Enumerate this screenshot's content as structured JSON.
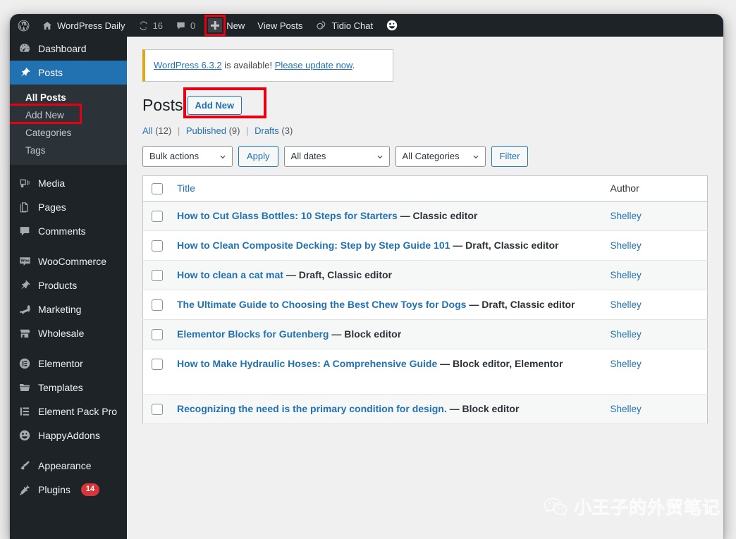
{
  "adminbar": {
    "site_name": "WordPress Daily",
    "updates_count": "16",
    "comments_count": "0",
    "new_label": "New",
    "view_posts_label": "View Posts",
    "tidio_label": "Tidio Chat"
  },
  "sidebar": {
    "items": [
      {
        "label": "Dashboard",
        "icon": "dashboard-icon"
      },
      {
        "label": "Posts",
        "icon": "pin-icon",
        "current": true
      },
      {
        "label": "Media",
        "icon": "media-icon"
      },
      {
        "label": "Pages",
        "icon": "pages-icon"
      },
      {
        "label": "Comments",
        "icon": "comment-icon"
      },
      {
        "label": "WooCommerce",
        "icon": "woocommerce-icon"
      },
      {
        "label": "Products",
        "icon": "pin-icon"
      },
      {
        "label": "Marketing",
        "icon": "megaphone-icon"
      },
      {
        "label": "Wholesale",
        "icon": "store-icon"
      },
      {
        "label": "Elementor",
        "icon": "elementor-icon"
      },
      {
        "label": "Templates",
        "icon": "folder-icon"
      },
      {
        "label": "Element Pack Pro",
        "icon": "element-pack-icon"
      },
      {
        "label": "HappyAddons",
        "icon": "happy-face-icon"
      },
      {
        "label": "Appearance",
        "icon": "brush-icon"
      },
      {
        "label": "Plugins",
        "icon": "plug-icon",
        "badge": "14"
      }
    ],
    "submenu": [
      {
        "label": "All Posts",
        "current": true
      },
      {
        "label": "Add New",
        "annotated": true
      },
      {
        "label": "Categories"
      },
      {
        "label": "Tags"
      }
    ]
  },
  "notice": {
    "link_version": "WordPress 6.3.2",
    "text_middle": " is available! ",
    "link_update": "Please update now",
    "text_end": "."
  },
  "page": {
    "title": "Posts",
    "add_new_label": "Add New"
  },
  "filters": {
    "all_label": "All",
    "all_count": "(12)",
    "published_label": "Published",
    "published_count": "(9)",
    "drafts_label": "Drafts",
    "drafts_count": "(3)",
    "separator": "|"
  },
  "tablenav": {
    "bulk_actions": "Bulk actions",
    "apply_label": "Apply",
    "all_dates": "All dates",
    "all_categories": "All Categories",
    "filter_label": "Filter"
  },
  "table": {
    "columns": {
      "title": "Title",
      "author": "Author"
    },
    "rows": [
      {
        "title": "How to Cut Glass Bottles: 10 Steps for Starters",
        "state": "— Classic editor",
        "author": "Shelley"
      },
      {
        "title": "How to Clean Composite Decking: Step by Step Guide 101",
        "state": "— Draft, Classic editor",
        "author": "Shelley"
      },
      {
        "title": "How to clean a cat mat",
        "state": "— Draft, Classic editor",
        "author": "Shelley"
      },
      {
        "title": "The Ultimate Guide to Choosing the Best Chew Toys for Dogs",
        "state": "— Draft, Classic editor",
        "author": "Shelley"
      },
      {
        "title": "Elementor Blocks for Gutenberg",
        "state": "— Block editor",
        "author": "Shelley"
      },
      {
        "title": "How to Make Hydraulic Hoses: A Comprehensive Guide",
        "state": "— Block editor, Elementor",
        "author": "Shelley"
      },
      {
        "title": "Recognizing the need is the primary condition for design.",
        "state": "— Block editor",
        "author": "Shelley"
      }
    ]
  },
  "watermark": {
    "text": "小王子的外贸笔记",
    "icon": "wechat-icon"
  },
  "colors": {
    "admin_dark": "#1d2327",
    "submenu_dark": "#2c3338",
    "accent_blue": "#2271b1",
    "annotation_red": "#e60012",
    "notice_amber": "#dba617",
    "badge_red": "#d63638"
  }
}
